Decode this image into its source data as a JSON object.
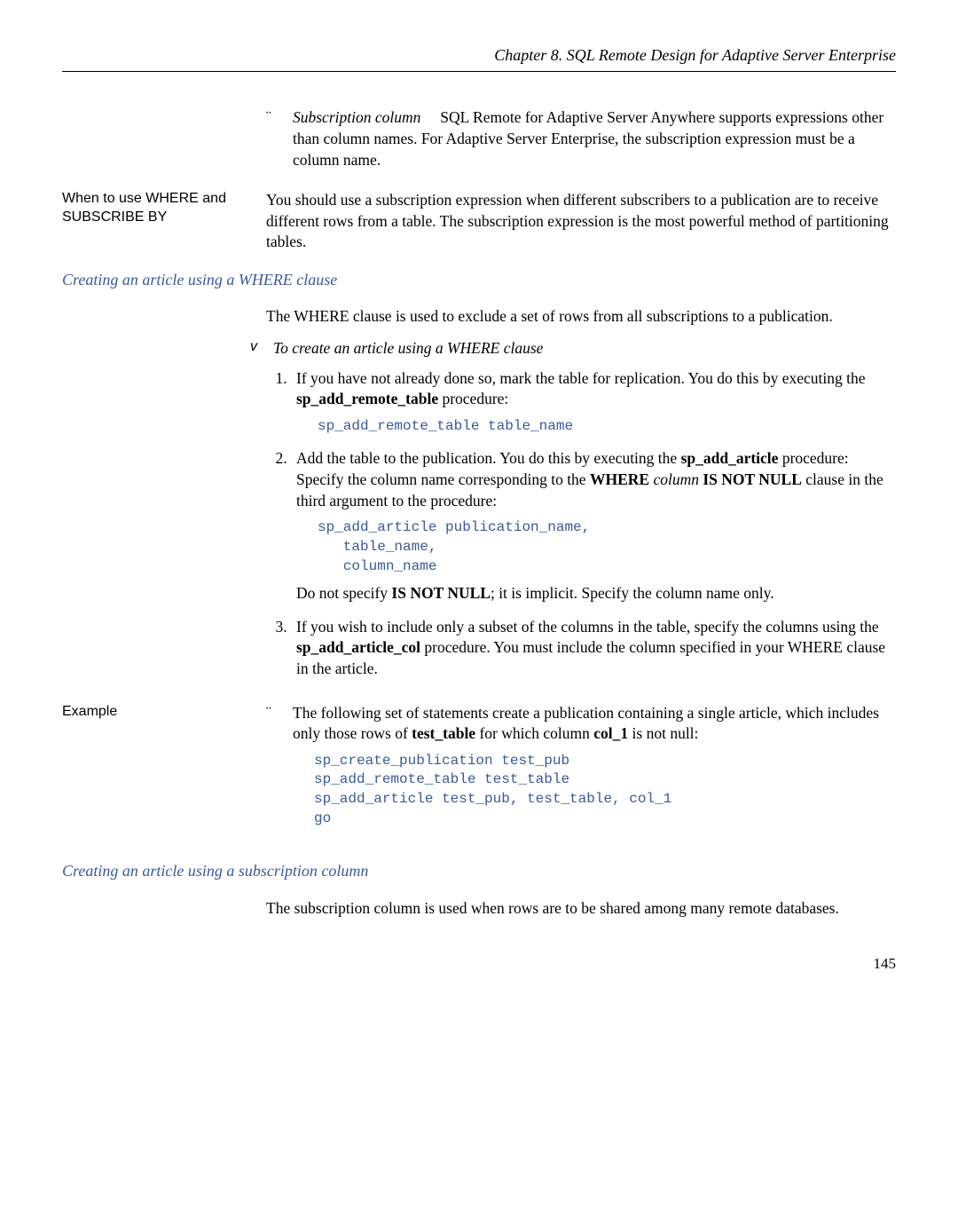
{
  "header": {
    "running": "Chapter 8.  SQL Remote Design for Adaptive Server Enterprise"
  },
  "intro_bullet": {
    "term": "Subscription column",
    "rest": "SQL Remote for Adaptive Server Anywhere supports expressions other than column names. For Adaptive Server Enterprise, the subscription expression must be a column name."
  },
  "when_side": "When to use WHERE and SUBSCRIBE BY",
  "when_body": "You should use a subscription expression when different subscribers to a publication are to receive different rows from a table. The subscription expression is the most powerful method of partitioning tables.",
  "sec1": {
    "title": "Creating an article using a WHERE clause",
    "intro": "The WHERE clause is used to exclude a set of rows from all subscriptions to a publication.",
    "proc_title": "To create an article using a WHERE clause",
    "step1a": "If you have not already done so, mark the table for replication. You do this by executing the ",
    "step1b": "sp_add_remote_table",
    "step1c": " procedure:",
    "code1": "sp_add_remote_table table_name",
    "step2a": "Add the table to the publication. You do this by executing the ",
    "step2b": "sp_add_article",
    "step2c": " procedure: Specify the column name corresponding to the ",
    "step2d": "WHERE",
    "step2e": " column ",
    "step2e_italic": "column",
    "step2f": "IS NOT NULL",
    "step2g": " clause in the third argument to the procedure:",
    "code2": "sp_add_article publication_name,\n   table_name,\n   column_name",
    "step2post_a": "Do not specify ",
    "step2post_b": "IS NOT NULL",
    "step2post_c": "; it is implicit. Specify the column name only.",
    "step3a": "If you wish to include only a subset of the columns in the table, specify the columns using the ",
    "step3b": "sp_add_article_col",
    "step3c": " procedure. You must include the column specified in your WHERE clause in the article."
  },
  "example": {
    "side": "Example",
    "lead_a": "The following set of statements create a publication containing a single article, which includes only those rows of ",
    "lead_b": "test_table",
    "lead_c": " for which column ",
    "lead_d": "col_1",
    "lead_e": " is not null:",
    "code": "sp_create_publication test_pub\nsp_add_remote_table test_table\nsp_add_article test_pub, test_table, col_1\ngo"
  },
  "sec2": {
    "title": "Creating an article using a subscription column",
    "body": "The subscription column is used when rows are to be shared among many remote databases."
  },
  "pagenum": "145"
}
